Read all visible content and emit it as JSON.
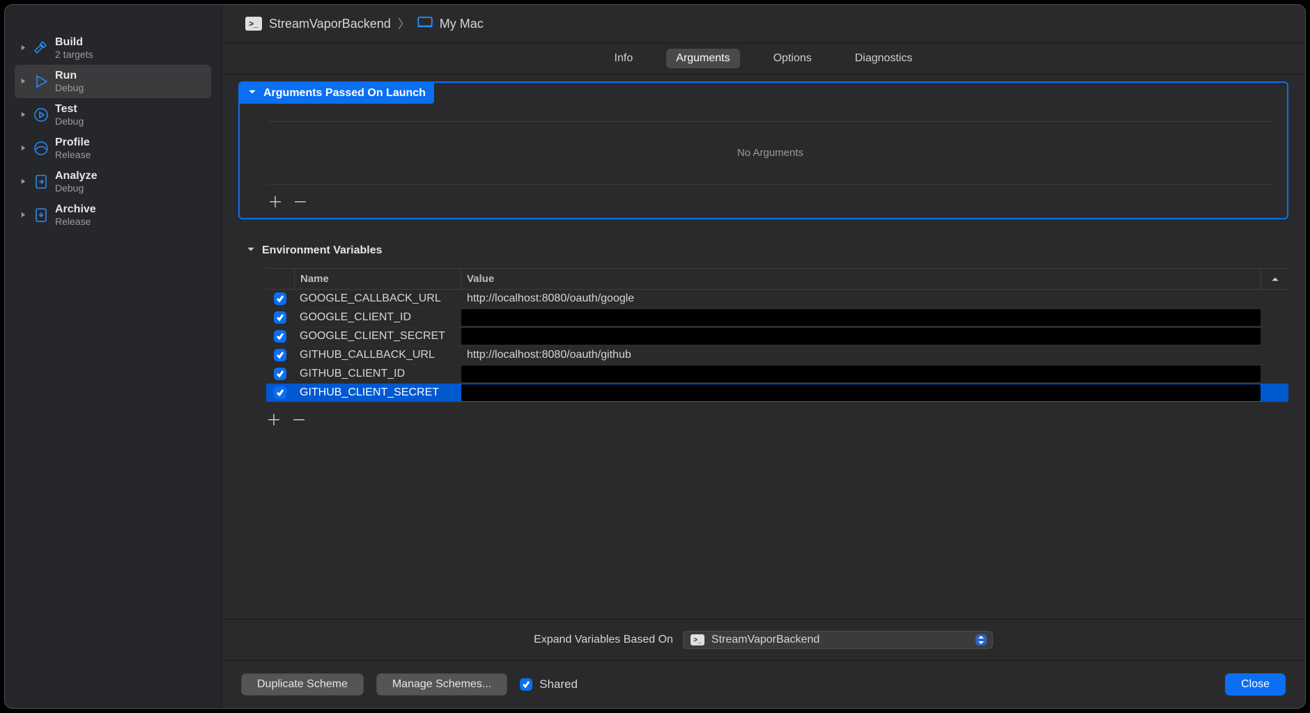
{
  "breadcrumb": {
    "project": "StreamVaporBackend",
    "target": "My Mac"
  },
  "sidebar": {
    "items": [
      {
        "title": "Build",
        "sub": "2 targets"
      },
      {
        "title": "Run",
        "sub": "Debug"
      },
      {
        "title": "Test",
        "sub": "Debug"
      },
      {
        "title": "Profile",
        "sub": "Release"
      },
      {
        "title": "Analyze",
        "sub": "Debug"
      },
      {
        "title": "Archive",
        "sub": "Release"
      }
    ]
  },
  "tabs": {
    "info": "Info",
    "arguments": "Arguments",
    "options": "Options",
    "diagnostics": "Diagnostics"
  },
  "sections": {
    "args_header": "Arguments Passed On Launch",
    "no_arguments": "No Arguments",
    "env_header": "Environment Variables",
    "col_name": "Name",
    "col_value": "Value"
  },
  "env_vars": [
    {
      "name": "GOOGLE_CALLBACK_URL",
      "value": "http://localhost:8080/oauth/google",
      "redacted": false
    },
    {
      "name": "GOOGLE_CLIENT_ID",
      "value": "",
      "redacted": true
    },
    {
      "name": "GOOGLE_CLIENT_SECRET",
      "value": "",
      "redacted": true
    },
    {
      "name": "GITHUB_CALLBACK_URL",
      "value": "http://localhost:8080/oauth/github",
      "redacted": false
    },
    {
      "name": "GITHUB_CLIENT_ID",
      "value": "",
      "redacted": true
    },
    {
      "name": "GITHUB_CLIENT_SECRET",
      "value": "",
      "redacted": true
    }
  ],
  "expand": {
    "label": "Expand Variables Based On",
    "scheme": "StreamVaporBackend"
  },
  "footer": {
    "duplicate": "Duplicate Scheme",
    "manage": "Manage Schemes...",
    "shared": "Shared",
    "close": "Close"
  }
}
